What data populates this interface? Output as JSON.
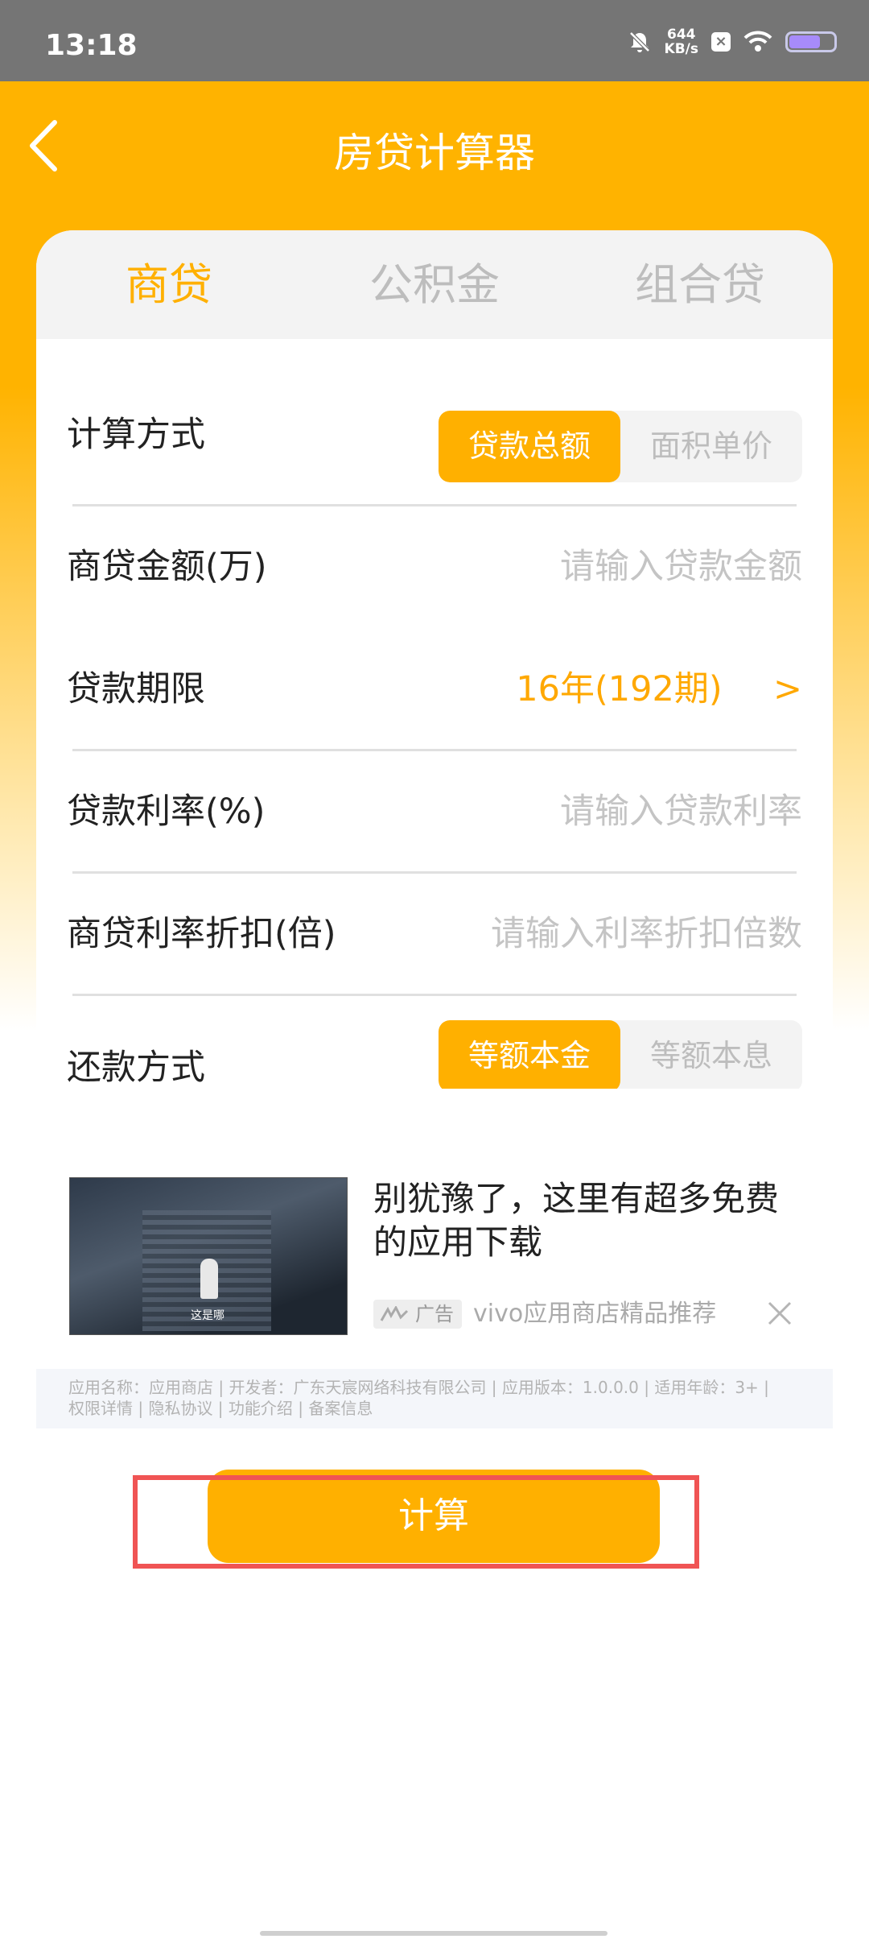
{
  "status_bar": {
    "time": "13:18",
    "net_speed_value": "644",
    "net_speed_unit": "KB/s"
  },
  "header": {
    "title": "房贷计算器"
  },
  "tabs": [
    {
      "label": "商贷",
      "active": true
    },
    {
      "label": "公积金",
      "active": false
    },
    {
      "label": "组合贷",
      "active": false
    }
  ],
  "form": {
    "calc_method": {
      "label": "计算方式",
      "options": [
        "贷款总额",
        "面积单价"
      ],
      "selected": "贷款总额"
    },
    "loan_amount": {
      "label": "商贷金额(万)",
      "placeholder": "请输入贷款金额"
    },
    "loan_term": {
      "label": "贷款期限",
      "value": "16年(192期)",
      "chevron": ">"
    },
    "loan_rate": {
      "label": "贷款利率(%)",
      "placeholder": "请输入贷款利率"
    },
    "rate_discount": {
      "label": "商贷利率折扣(倍)",
      "placeholder": "请输入利率折扣倍数"
    },
    "repayment": {
      "label": "还款方式",
      "options": [
        "等额本金",
        "等额本息"
      ],
      "selected": "等额本金"
    }
  },
  "ad": {
    "title": "别犹豫了，这里有超多免费的应用下载",
    "badge": "广告",
    "source": "vivo应用商店精品推荐",
    "image_caption": "这是哪",
    "info_line1": "应用名称：应用商店 | 开发者：广东天宸网络科技有限公司 | 应用版本：1.0.0.0 | 适用年龄：3+ |",
    "info_line2": "权限详情 | 隐私协议 | 功能介绍 | 备案信息"
  },
  "actions": {
    "calculate_label": "计算"
  },
  "colors": {
    "accent": "#ffb000",
    "highlight": "#f05454",
    "status_bar": "#757575"
  }
}
